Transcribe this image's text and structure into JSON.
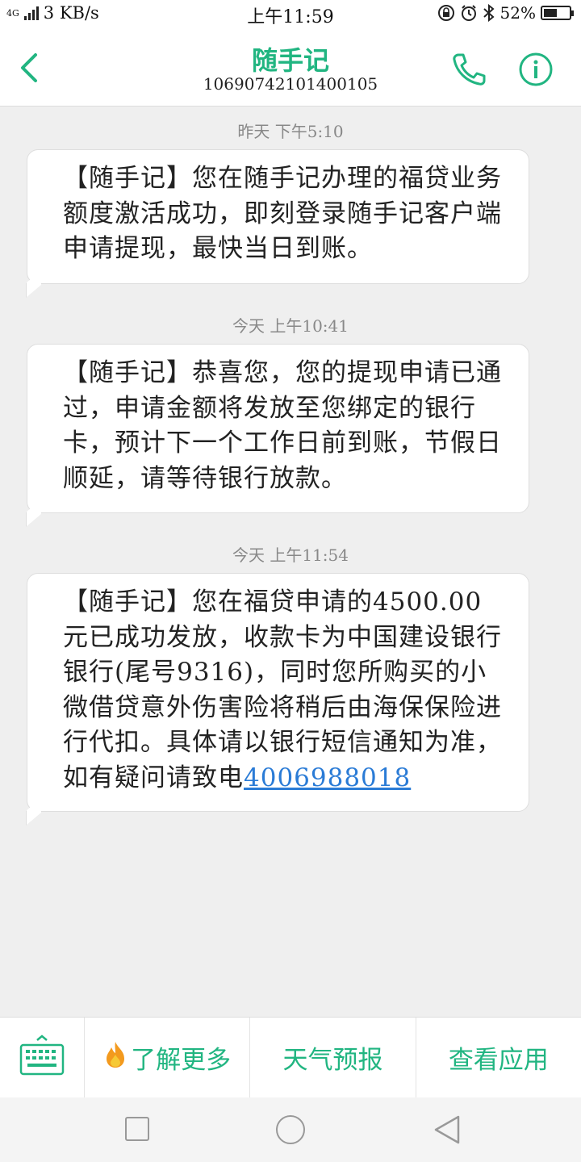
{
  "status": {
    "network": "4G",
    "speed": "3 KB/s",
    "time": "上午11:59",
    "battery": "52%",
    "battery_level": 0.52
  },
  "header": {
    "title": "随手记",
    "number": "10690742101400105"
  },
  "messages": [
    {
      "timestamp": "昨天 下午5:10",
      "text": "【随手记】您在随手记办理的福贷业务额度激活成功，即刻登录随手记客户端申请提现，最快当日到账。"
    },
    {
      "timestamp": "今天 上午10:41",
      "text": "【随手记】恭喜您，您的提现申请已通过，申请金额将发放至您绑定的银行卡，预计下一个工作日前到账，节假日顺延，请等待银行放款。"
    },
    {
      "timestamp": "今天 上午11:54",
      "text": "【随手记】您在福贷申请的4500.00元已成功发放，收款卡为中国建设银行银行(尾号9316)，同时您所购买的小微借贷意外伤害险将稍后由海保保险进行代扣。具体请以银行短信通知为准，如有疑问请致电",
      "link": "4006988018"
    }
  ],
  "bottom_menu": {
    "item1": "了解更多",
    "item2": "天气预报",
    "item3": "查看应用"
  },
  "icons": {
    "back": "chevron-left-icon",
    "call": "phone-icon",
    "info": "info-icon",
    "keyboard": "keyboard-icon",
    "fire": "fire-icon"
  },
  "colors": {
    "accent": "#21b581",
    "link": "#2a7bd6"
  }
}
